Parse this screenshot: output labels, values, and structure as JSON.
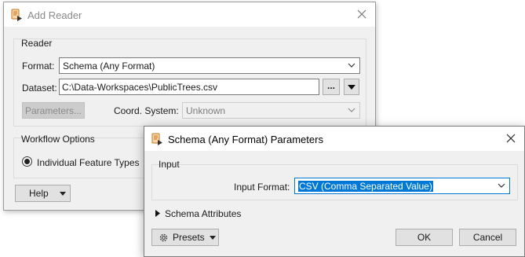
{
  "add_reader": {
    "title": "Add Reader",
    "reader_group": "Reader",
    "format_label": "Format:",
    "format_value": "Schema (Any Format)",
    "dataset_label": "Dataset:",
    "dataset_value": "C:\\Data-Workspaces\\PublicTrees.csv",
    "browse_label": "...",
    "parameters_label": "Parameters...",
    "coord_label": "Coord. System:",
    "coord_value": "Unknown",
    "workflow_group": "Workflow Options",
    "individual_label": "Individual Feature Types",
    "help_label": "Help"
  },
  "schema_params": {
    "title": "Schema (Any Format) Parameters",
    "input_group": "Input",
    "input_format_label": "Input Format:",
    "input_format_value": "CSV (Comma Separated Value)",
    "schema_attributes_label": "Schema Attributes",
    "presets_label": "Presets",
    "ok_label": "OK",
    "cancel_label": "Cancel"
  },
  "colors": {
    "selection": "#0078d7",
    "dialog_bg": "#f0f0f0",
    "icon_orange": "#d9822b"
  }
}
